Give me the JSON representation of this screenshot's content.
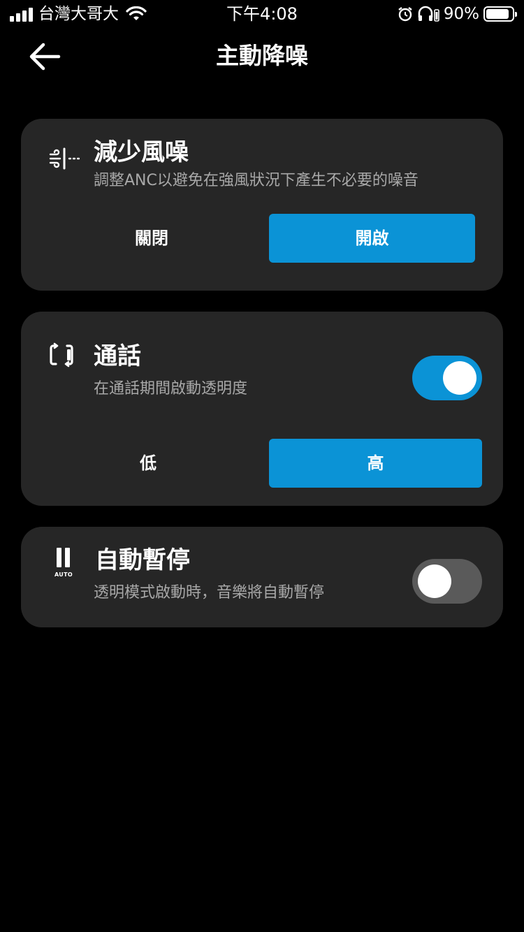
{
  "status_bar": {
    "carrier": "台灣大哥大",
    "time": "下午4:08",
    "battery_percent": "90%",
    "icons": [
      "signal-icon",
      "wifi-icon",
      "alarm-icon",
      "headphones-icon",
      "battery-icon"
    ]
  },
  "header": {
    "title": "主動降噪",
    "back_icon": "arrow-left-icon"
  },
  "wind_noise": {
    "title": "減少風噪",
    "description": "調整ANC以避免在強風狀況下產生不必要的噪音",
    "icon": "wind-icon",
    "options": [
      "關閉",
      "開啟"
    ],
    "selected": "開啟"
  },
  "call": {
    "title": "通話",
    "description": "在通話期間啟動透明度",
    "icon": "phone-swap-icon",
    "toggle_on": true,
    "options": [
      "低",
      "高"
    ],
    "selected": "高"
  },
  "auto_pause": {
    "title": "自動暫停",
    "description": "透明模式啟動時，音樂將自動暫停",
    "icon": "pause-auto-icon",
    "icon_caption": "AUTO",
    "toggle_on": false
  },
  "colors": {
    "accent": "#0b93d6",
    "card_bg": "#262626",
    "background": "#000000",
    "secondary_text": "#a8a8a8",
    "toggle_off": "#5a5a5a"
  }
}
